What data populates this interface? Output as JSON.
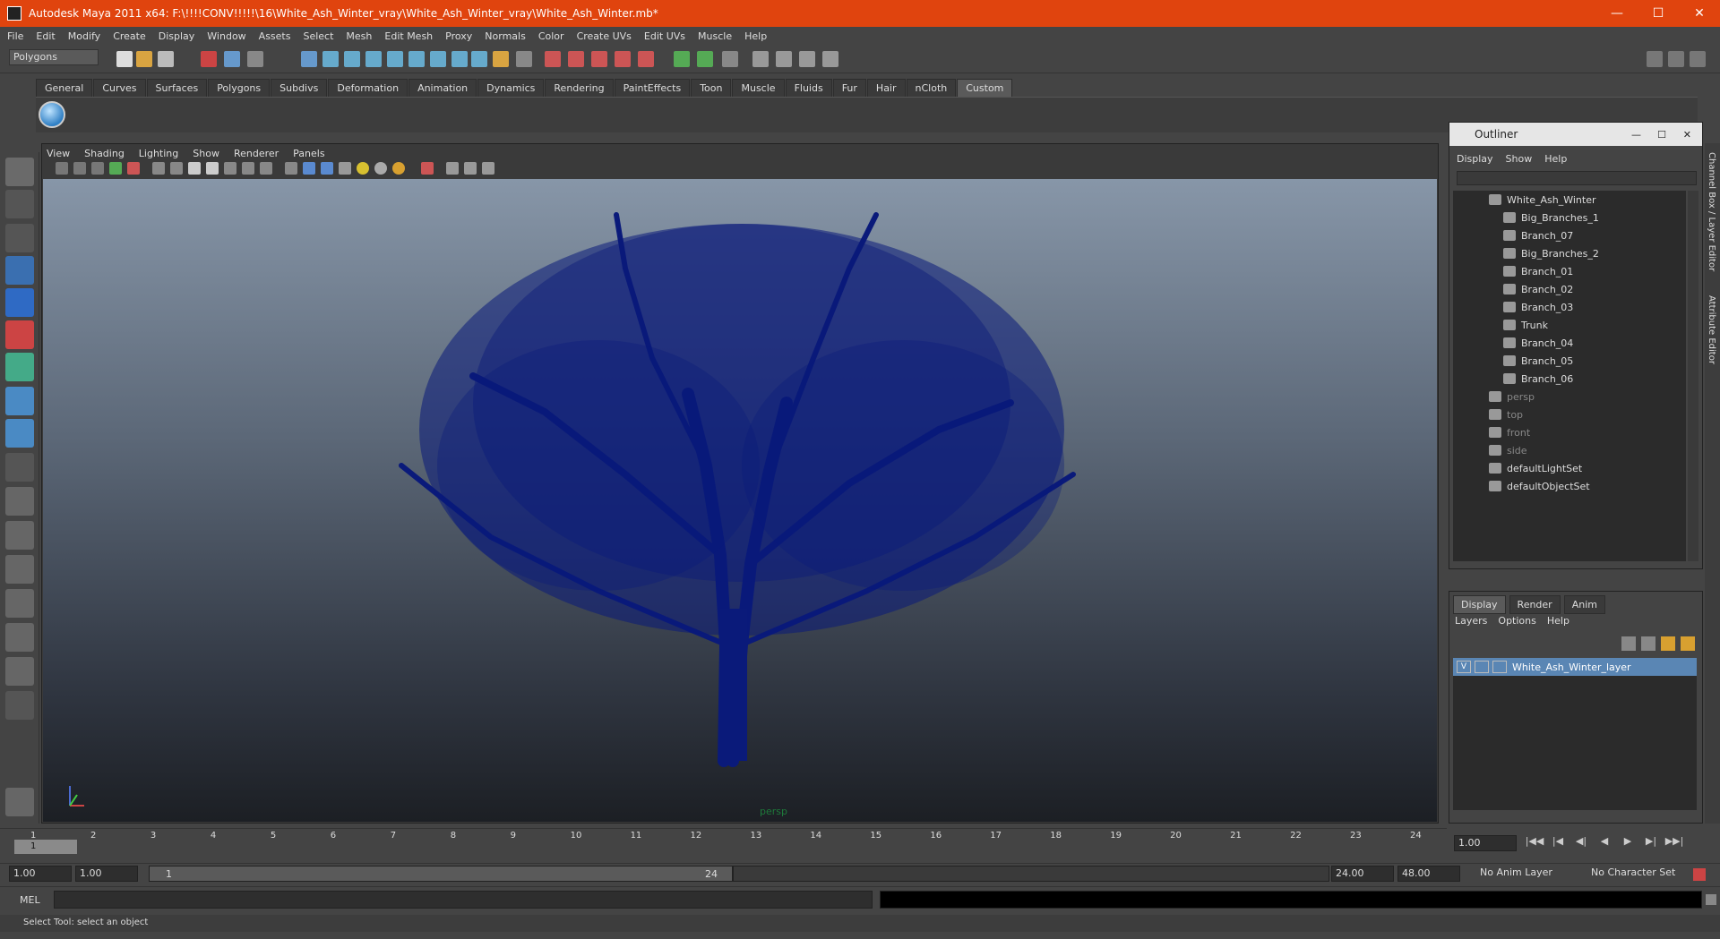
{
  "window": {
    "title": "Autodesk Maya 2011 x64: F:\\!!!!CONV!!!!!\\16\\White_Ash_Winter_vray\\White_Ash_Winter_vray\\White_Ash_Winter.mb*",
    "minimize": "—",
    "maximize": "☐",
    "close": "✕"
  },
  "menubar": [
    "File",
    "Edit",
    "Modify",
    "Create",
    "Display",
    "Window",
    "Assets",
    "Select",
    "Mesh",
    "Edit Mesh",
    "Proxy",
    "Normals",
    "Color",
    "Create UVs",
    "Edit UVs",
    "Muscle",
    "Help"
  ],
  "status_line": {
    "mode": "Polygons"
  },
  "shelf_tabs": [
    "General",
    "Curves",
    "Surfaces",
    "Polygons",
    "Subdivs",
    "Deformation",
    "Animation",
    "Dynamics",
    "Rendering",
    "PaintEffects",
    "Toon",
    "Muscle",
    "Fluids",
    "Fur",
    "Hair",
    "nCloth",
    "Custom"
  ],
  "active_shelf": "Custom",
  "panel_menu": [
    "View",
    "Shading",
    "Lighting",
    "Show",
    "Renderer",
    "Panels"
  ],
  "viewport": {
    "camera_label": "persp"
  },
  "outliner": {
    "title": "Outliner",
    "menu": [
      "Display",
      "Show",
      "Help"
    ],
    "items": [
      {
        "label": "White_Ash_Winter",
        "indent": 0,
        "dim": false
      },
      {
        "label": "Big_Branches_1",
        "indent": 1,
        "dim": false
      },
      {
        "label": "Branch_07",
        "indent": 1,
        "dim": false
      },
      {
        "label": "Big_Branches_2",
        "indent": 1,
        "dim": false
      },
      {
        "label": "Branch_01",
        "indent": 1,
        "dim": false
      },
      {
        "label": "Branch_02",
        "indent": 1,
        "dim": false
      },
      {
        "label": "Branch_03",
        "indent": 1,
        "dim": false
      },
      {
        "label": "Trunk",
        "indent": 1,
        "dim": false
      },
      {
        "label": "Branch_04",
        "indent": 1,
        "dim": false
      },
      {
        "label": "Branch_05",
        "indent": 1,
        "dim": false
      },
      {
        "label": "Branch_06",
        "indent": 1,
        "dim": false
      },
      {
        "label": "persp",
        "indent": 0,
        "dim": true
      },
      {
        "label": "top",
        "indent": 0,
        "dim": true
      },
      {
        "label": "front",
        "indent": 0,
        "dim": true
      },
      {
        "label": "side",
        "indent": 0,
        "dim": true
      },
      {
        "label": "defaultLightSet",
        "indent": 0,
        "dim": false
      },
      {
        "label": "defaultObjectSet",
        "indent": 0,
        "dim": false
      }
    ]
  },
  "layer_editor": {
    "tabs": [
      "Display",
      "Render",
      "Anim"
    ],
    "active_tab": "Display",
    "menu": [
      "Layers",
      "Options",
      "Help"
    ],
    "layer": {
      "visible": "V",
      "name": "White_Ash_Winter_layer"
    }
  },
  "side_tabs": [
    "Channel Box / Layer Editor",
    "Attribute Editor"
  ],
  "time_slider": {
    "ticks": [
      "1",
      "2",
      "3",
      "4",
      "5",
      "6",
      "7",
      "8",
      "9",
      "10",
      "11",
      "12",
      "13",
      "14",
      "15",
      "16",
      "17",
      "18",
      "19",
      "20",
      "21",
      "22",
      "23",
      "24"
    ],
    "current_marker": "1",
    "current_frame": "1.00"
  },
  "playback_buttons": [
    "|◀◀",
    "|◀",
    "◀|",
    "◀",
    "▶",
    "▶|",
    "▶▶|"
  ],
  "range": {
    "start_time": "1.00",
    "playback_start": "1.00",
    "slider_start": "1",
    "slider_end": "24",
    "playback_end": "24.00",
    "end_time": "48.00",
    "anim_layer": "No Anim Layer",
    "character_set": "No Character Set"
  },
  "command_line": {
    "label": "MEL"
  },
  "help_line": {
    "text": "Select Tool: select an object"
  },
  "colors": {
    "titlebar": "#e0440e",
    "tree": "#0a1a7a",
    "selection": "#5a86b4"
  }
}
